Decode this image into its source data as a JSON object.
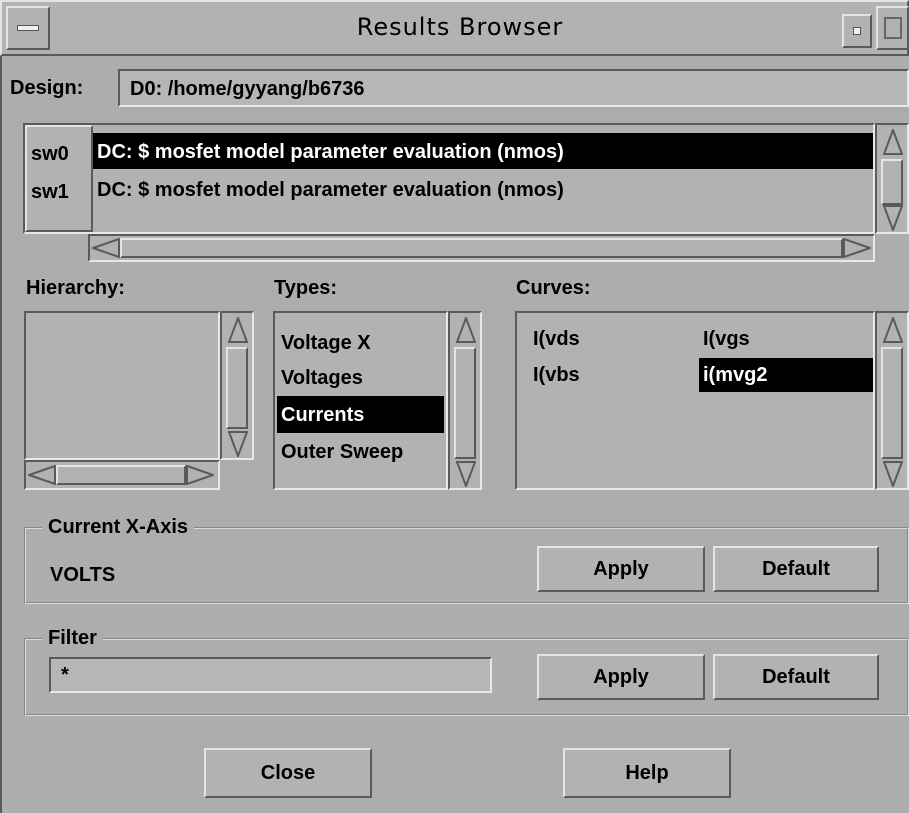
{
  "window": {
    "title": "Results Browser"
  },
  "design": {
    "label": "Design:",
    "value": "D0: /home/gyyang/b6736"
  },
  "results": {
    "tags": [
      "sw0",
      "sw1"
    ],
    "rows": [
      {
        "text": "DC: $ mosfet model parameter evaluation (nmos)",
        "selected": true
      },
      {
        "text": "DC: $ mosfet model parameter evaluation (nmos)",
        "selected": false
      }
    ]
  },
  "hierarchy": {
    "label": "Hierarchy:"
  },
  "types": {
    "label": "Types:",
    "items": [
      "Voltage X",
      "Voltages",
      "Currents",
      "Outer Sweep"
    ],
    "selected": "Currents"
  },
  "curves": {
    "label": "Curves:",
    "items": [
      "I(vds",
      "I(vgs",
      "I(vbs",
      "i(mvg2"
    ],
    "selected": "i(mvg2"
  },
  "xaxis": {
    "legend": "Current X-Axis",
    "value": "VOLTS",
    "apply_label": "Apply",
    "default_label": "Default"
  },
  "filter": {
    "legend": "Filter",
    "value": "*",
    "apply_label": "Apply",
    "default_label": "Default"
  },
  "footer": {
    "close_label": "Close",
    "help_label": "Help"
  }
}
